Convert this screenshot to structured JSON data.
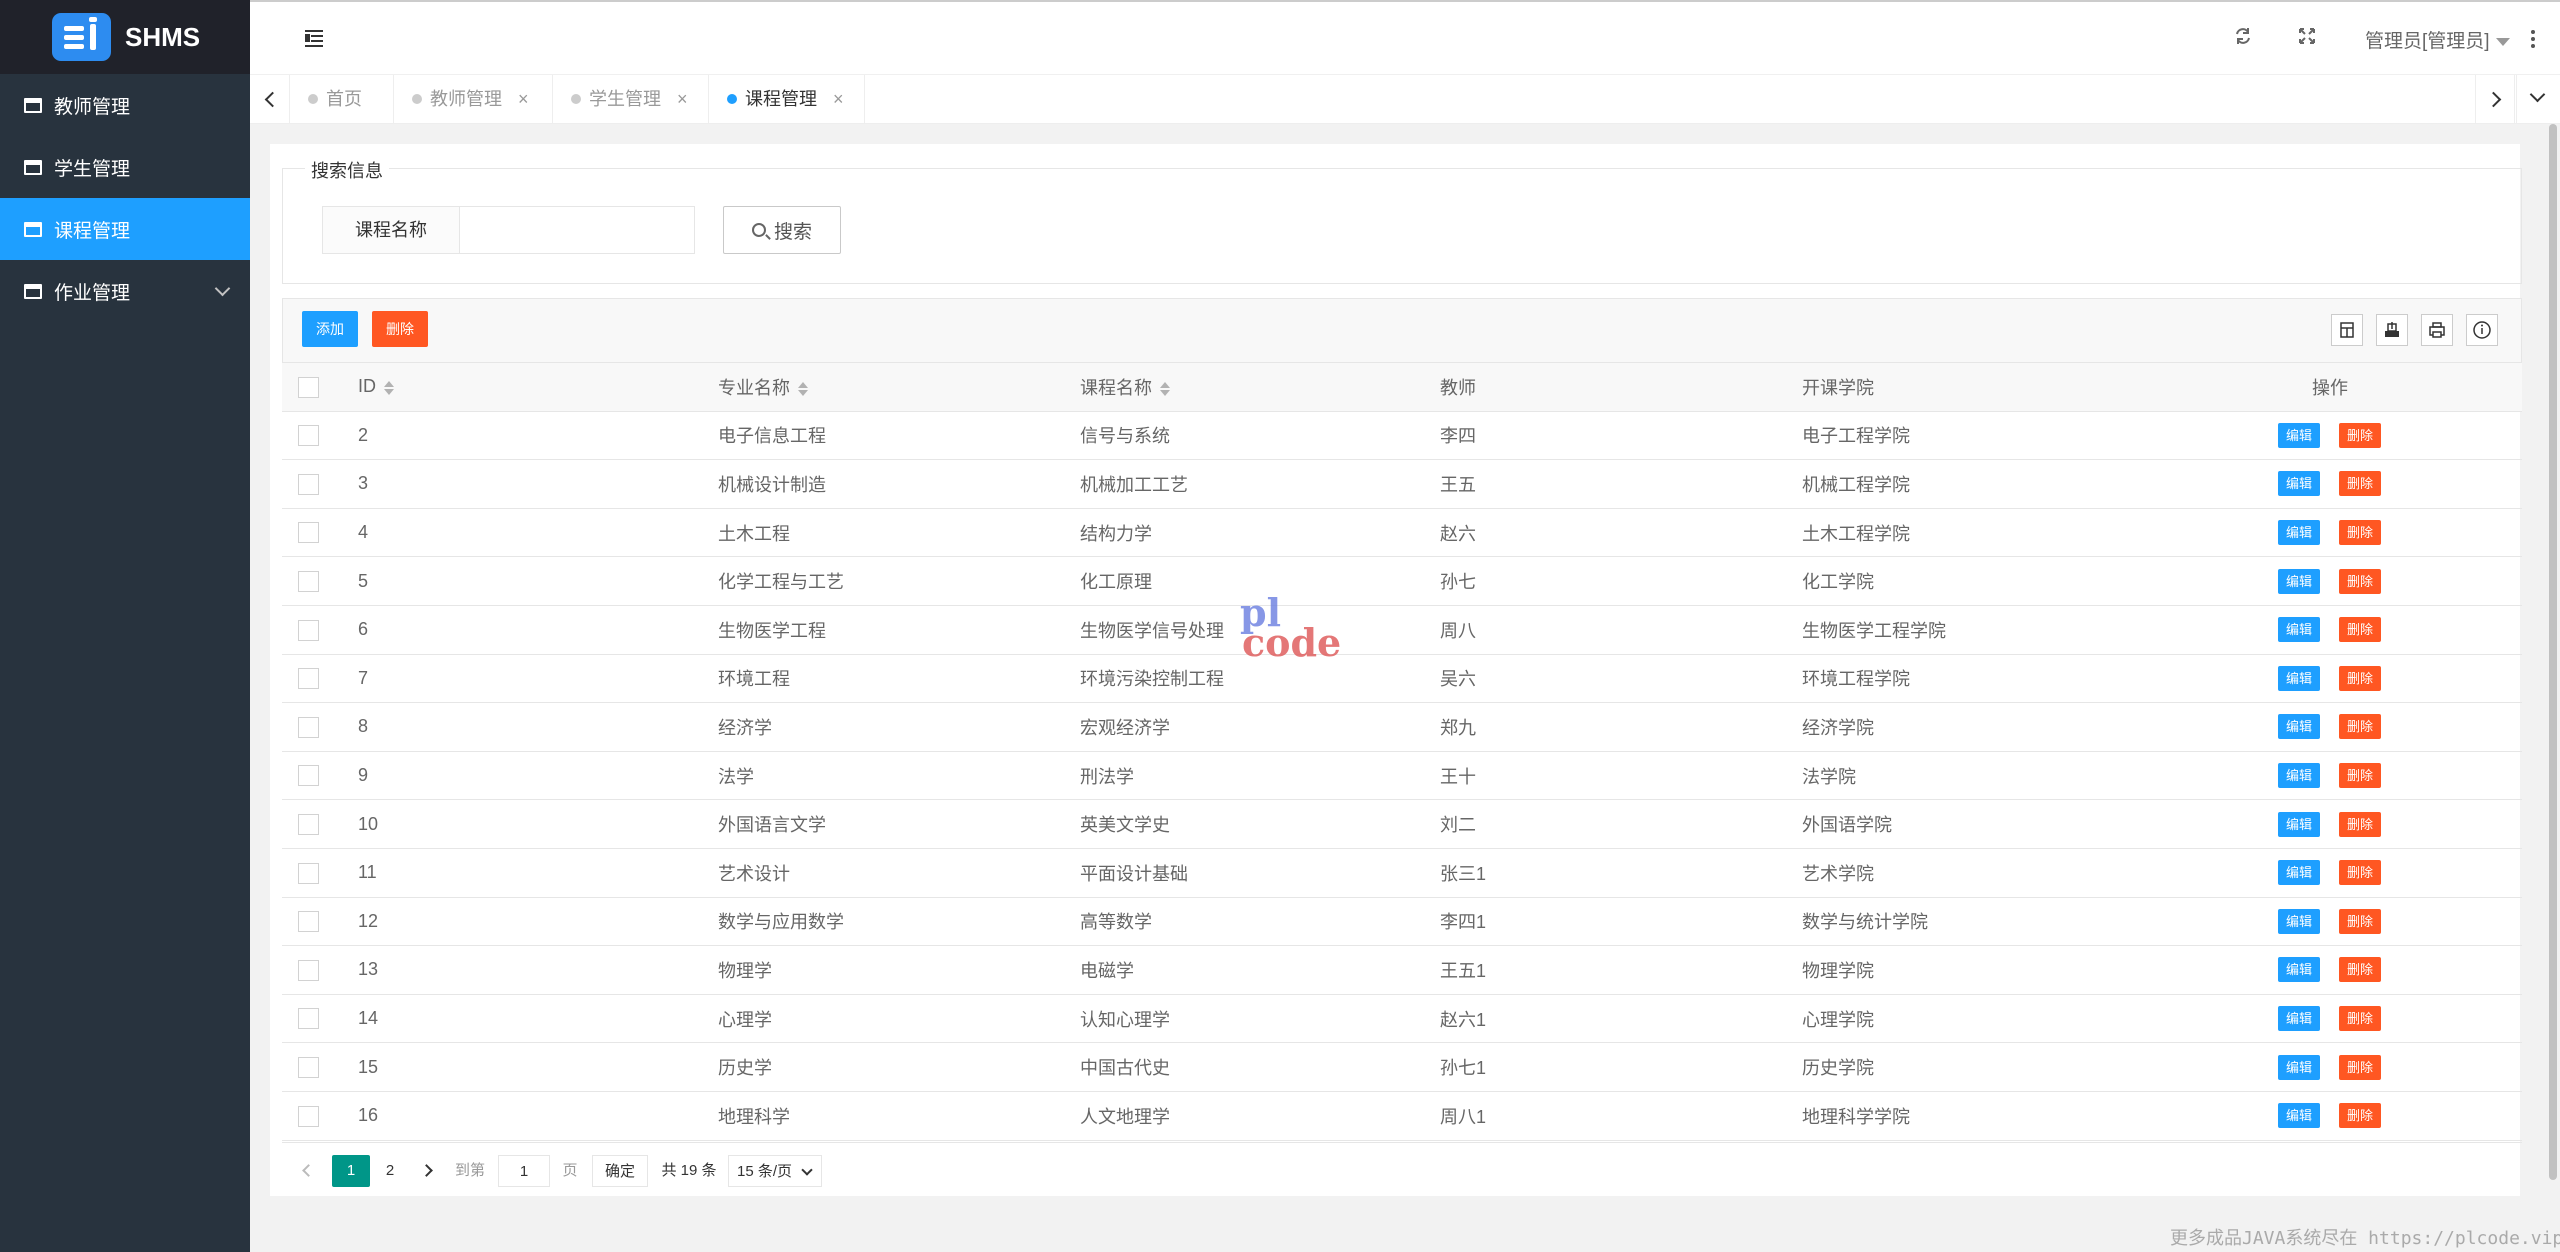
{
  "app": {
    "title": "SHMS"
  },
  "sidebar": {
    "items": [
      {
        "label": "教师管理"
      },
      {
        "label": "学生管理"
      },
      {
        "label": "课程管理",
        "active": true
      },
      {
        "label": "作业管理",
        "expandable": true
      }
    ]
  },
  "header": {
    "user": "管理员[管理员]"
  },
  "tabs": [
    {
      "label": "首页"
    },
    {
      "label": "教师管理"
    },
    {
      "label": "学生管理"
    },
    {
      "label": "课程管理",
      "active": true
    }
  ],
  "search": {
    "legend": "搜索信息",
    "field_label": "课程名称",
    "input_value": "",
    "button_label": "搜索"
  },
  "toolbar": {
    "add_label": "添加",
    "delete_label": "删除"
  },
  "table": {
    "headers": [
      "ID",
      "专业名称",
      "课程名称",
      "教师",
      "开课学院",
      "操作"
    ],
    "edit_label": "编辑",
    "delete_label": "删除",
    "rows": [
      [
        "2",
        "电子信息工程",
        "信号与系统",
        "李四",
        "电子工程学院"
      ],
      [
        "3",
        "机械设计制造",
        "机械加工工艺",
        "王五",
        "机械工程学院"
      ],
      [
        "4",
        "土木工程",
        "结构力学",
        "赵六",
        "土木工程学院"
      ],
      [
        "5",
        "化学工程与工艺",
        "化工原理",
        "孙七",
        "化工学院"
      ],
      [
        "6",
        "生物医学工程",
        "生物医学信号处理",
        "周八",
        "生物医学工程学院"
      ],
      [
        "7",
        "环境工程",
        "环境污染控制工程",
        "吴六",
        "环境工程学院"
      ],
      [
        "8",
        "经济学",
        "宏观经济学",
        "郑九",
        "经济学院"
      ],
      [
        "9",
        "法学",
        "刑法学",
        "王十",
        "法学院"
      ],
      [
        "10",
        "外国语言文学",
        "英美文学史",
        "刘二",
        "外国语学院"
      ],
      [
        "11",
        "艺术设计",
        "平面设计基础",
        "张三1",
        "艺术学院"
      ],
      [
        "12",
        "数学与应用数学",
        "高等数学",
        "李四1",
        "数学与统计学院"
      ],
      [
        "13",
        "物理学",
        "电磁学",
        "王五1",
        "物理学院"
      ],
      [
        "14",
        "心理学",
        "认知心理学",
        "赵六1",
        "心理学院"
      ],
      [
        "15",
        "历史学",
        "中国古代史",
        "孙七1",
        "历史学院"
      ],
      [
        "16",
        "地理科学",
        "人文地理学",
        "周八1",
        "地理科学学院"
      ]
    ]
  },
  "pagination": {
    "current": "1",
    "page2": "2",
    "goto_label": "到第",
    "goto_value": "1",
    "page_unit": "页",
    "confirm_label": "确定",
    "total": "共 19 条",
    "page_size": "15 条/页"
  },
  "watermark": {
    "top": "pl",
    "bottom": "code"
  },
  "footer": {
    "note": "更多成品JAVA系统尽在 https://plcode.vip"
  },
  "colors": {
    "sidebar": "#28333e",
    "active": "#1e9fff",
    "danger": "#ff5722",
    "pager_active": "#009688"
  },
  "icons": [
    "menu-toggle-icon",
    "refresh-icon",
    "fullscreen-icon",
    "more-icon",
    "filter-columns-icon",
    "export-icon",
    "print-icon",
    "info-icon",
    "search-icon"
  ]
}
